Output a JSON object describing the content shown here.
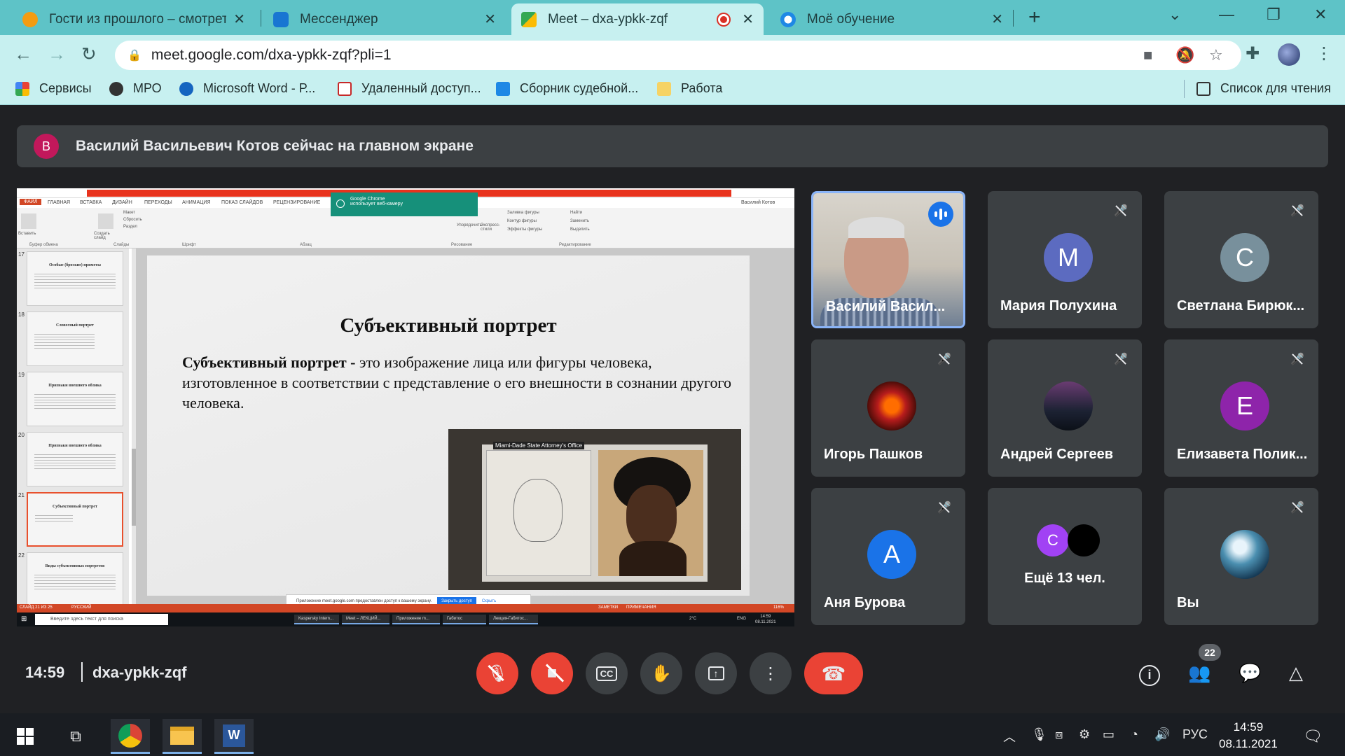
{
  "tabs": [
    {
      "title": "Гости из прошлого – смотреть",
      "close": "✕"
    },
    {
      "title": "Мессенджер",
      "close": "✕"
    },
    {
      "title": "Meet – dxa-ypkk-zqf",
      "close": "✕"
    },
    {
      "title": "Моё обучение",
      "close": "✕"
    }
  ],
  "browser": {
    "url": "meet.google.com/dxa-ypkk-zqf?pli=1",
    "bookmarks": [
      "Сервисы",
      "МРО",
      "Microsoft Word - Р...",
      "Удаленный доступ...",
      "Сборник судебной...",
      "Работа"
    ],
    "reading_list": "Список для чтения"
  },
  "banner": {
    "avatar_letter": "В",
    "text": "Василий Васильевич Котов сейчас на главном экране"
  },
  "ppt": {
    "ribbon_tabs": [
      "ФАЙЛ",
      "ГЛАВНАЯ",
      "ВСТАВКА",
      "ДИЗАЙН",
      "ПЕРЕХОДЫ",
      "АНИМАЦИЯ",
      "ПОКАЗ СЛАЙДОВ",
      "РЕЦЕНЗИРОВАНИЕ"
    ],
    "user": "Василий Котов",
    "toast_line1": "Google Chrome",
    "toast_line2": "использует веб-камеру",
    "ribbon_groups": [
      "Буфер обмена",
      "Слайды",
      "Шрифт",
      "Абзац",
      "Рисование",
      "Редактирование"
    ],
    "ribbon_items": [
      "Вставить",
      "Создать слайд",
      "Макет",
      "Сбросить",
      "Раздел",
      "Упорядочить",
      "Экспресс-стили",
      "Заливка фигуры",
      "Контур фигуры",
      "Эффекты фигуры",
      "Найти",
      "Заменить",
      "Выделить"
    ],
    "thumbs": [
      {
        "num": "17",
        "title": "Особые (броские) приметы"
      },
      {
        "num": "18",
        "title": "Словесный портрет"
      },
      {
        "num": "19",
        "title": "Признаки внешнего облика"
      },
      {
        "num": "20",
        "title": "Признаки внешнего облика"
      },
      {
        "num": "21",
        "title": "Субъективный портрет"
      },
      {
        "num": "22",
        "title": "Виды субъективных портретов"
      }
    ],
    "slide_title": "Субъективный портрет",
    "slide_term": "Субъективный портрет -",
    "slide_text": " это изображение лица или фигуры человека, изготовленное в соответствии с представление о его внешности в сознании другого человека.",
    "photo_caption": "Miami-Dade State Attorney's Office",
    "share_text": "Приложение meet.google.com предоставлен доступ к вашему экрану.",
    "share_btn": "Закрыть доступ",
    "share_hide": "Скрыть",
    "status_left": "СЛАЙД 21 ИЗ 25",
    "status_lang": "РУССКИЙ",
    "status_notes": "ЗАМЕТКИ",
    "status_comments": "ПРИМЕЧАНИЯ",
    "status_zoom": "116%",
    "task_search": "Введите здесь текст для поиска",
    "task_apps": [
      "Kaspersky Intern...",
      "Meet – ЛЕКЦИЙ...",
      "Приложение m...",
      "Габитос",
      "Лекция-Габитос..."
    ],
    "task_temp": "2°C",
    "task_lang": "ENG",
    "task_time": "14:59",
    "task_date": "08.11.2021"
  },
  "participants": [
    {
      "name": "Василий Васил...",
      "type": "video"
    },
    {
      "name": "Мария Полухина",
      "letter": "М",
      "color": "#5c6bc0"
    },
    {
      "name": "Светлана Бирюк...",
      "letter": "С",
      "color": "#78909c"
    },
    {
      "name": "Игорь Пашков",
      "type": "image"
    },
    {
      "name": "Андрей Сергеев",
      "type": "image"
    },
    {
      "name": "Елизавета Полик...",
      "letter": "Е",
      "color": "#8e24aa"
    },
    {
      "name": "Аня Бурова",
      "letter": "А",
      "color": "#1a73e8"
    },
    {
      "more_letter": "С",
      "more_label": "Ещё 13 чел."
    },
    {
      "name": "Вы",
      "type": "image"
    }
  ],
  "meeting": {
    "time": "14:59",
    "code": "dxa-ypkk-zqf",
    "people_count": "22"
  },
  "taskbar": {
    "lang": "РУС",
    "time": "14:59",
    "date": "08.11.2021"
  },
  "colors": {
    "meet_bg": "#202124",
    "tile_bg": "#3c4043",
    "danger": "#ea4335",
    "accent": "#1a73e8",
    "chrome_tab": "#5ec3c7"
  }
}
